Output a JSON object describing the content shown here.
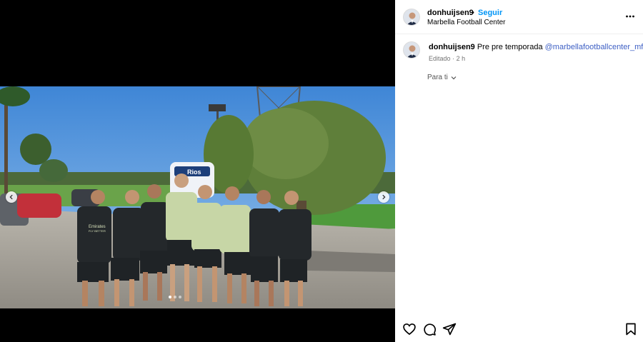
{
  "post": {
    "username": "donhuijsen9",
    "separator": "•",
    "follow_label": "Seguir",
    "location": "Marbella Football Center"
  },
  "caption": {
    "username": "donhuijsen9",
    "text": "Pre pre temporada",
    "mention": "@marbellafootballcenter_mfc",
    "edited_label": "Editado",
    "time_separator": "·",
    "time": "2 h",
    "translate_label": "Para ti"
  },
  "photo": {
    "jersey_text_line1": "Emirates",
    "jersey_text_line2": "FLY BETTER",
    "vehicle_text": "Rios",
    "carousel": {
      "total": 3,
      "active": 1
    }
  },
  "icons": {
    "prev": "chevron-left-icon",
    "next": "chevron-right-icon",
    "more": "more-options-icon",
    "like": "heart-icon",
    "comment": "comment-icon",
    "share": "send-icon",
    "save": "bookmark-icon"
  },
  "colors": {
    "link_blue": "#0095f6",
    "mention": "#3d5fc4",
    "muted": "#737373"
  }
}
